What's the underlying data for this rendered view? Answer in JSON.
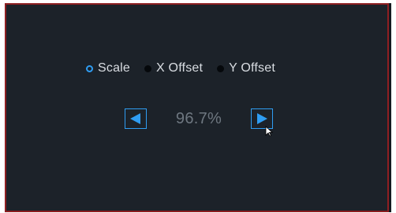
{
  "radio_group": {
    "options": [
      {
        "label": "Scale",
        "checked": true
      },
      {
        "label": "X Offset",
        "checked": false
      },
      {
        "label": "Y Offset",
        "checked": false
      }
    ]
  },
  "stepper": {
    "value": "96.7%",
    "decrease_icon": "left-arrow-icon",
    "increase_icon": "right-arrow-icon"
  },
  "colors": {
    "accent": "#2f9df2",
    "panel_bg": "#1c2229",
    "border": "#8e1f22",
    "value_text": "#6e7780"
  }
}
